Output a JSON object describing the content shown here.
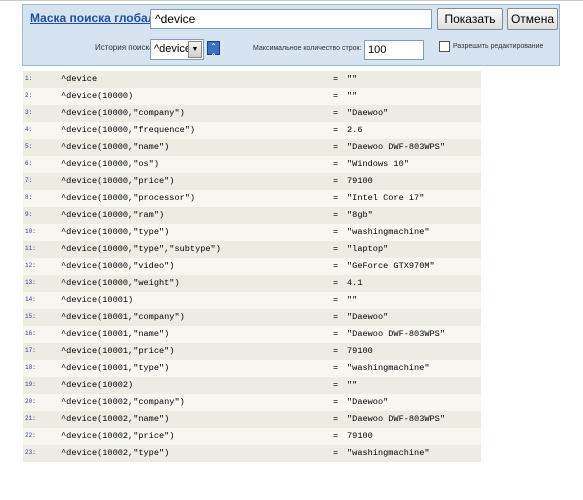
{
  "search": {
    "mask_label": "Маска поиска глобалов:",
    "mask_value": "^device",
    "show_button": "Показать",
    "cancel_button": "Отмена",
    "history_label": "История поиска:",
    "history_selected": "^device",
    "max_rows_label": "Максимальное количество строк:",
    "max_rows_value": "100",
    "allow_edit_label": "Разрешить редактирование",
    "allow_edit_checked": false
  },
  "rows": [
    {
      "num": "1:",
      "key": "^device",
      "val": "\"\""
    },
    {
      "num": "2:",
      "key": "^device(10000)",
      "val": "\"\""
    },
    {
      "num": "3:",
      "key": "^device(10000,\"company\")",
      "val": "\"Daewoo\""
    },
    {
      "num": "4:",
      "key": "^device(10000,\"frequence\")",
      "val": "2.6"
    },
    {
      "num": "5:",
      "key": "^device(10000,\"name\")",
      "val": "\"Daewoo DWF-803WPS\""
    },
    {
      "num": "6:",
      "key": "^device(10000,\"os\")",
      "val": "\"Windows 10\""
    },
    {
      "num": "7:",
      "key": "^device(10000,\"price\")",
      "val": "79100"
    },
    {
      "num": "8:",
      "key": "^device(10000,\"processor\")",
      "val": "\"Intel Core i7\""
    },
    {
      "num": "9:",
      "key": "^device(10000,\"ram\")",
      "val": "\"8gb\""
    },
    {
      "num": "10:",
      "key": "^device(10000,\"type\")",
      "val": "\"washingmachine\""
    },
    {
      "num": "11:",
      "key": "^device(10000,\"type\",\"subtype\")",
      "val": "\"laptop\""
    },
    {
      "num": "12:",
      "key": "^device(10000,\"video\")",
      "val": "\"GeForce GTX970M\""
    },
    {
      "num": "13:",
      "key": "^device(10000,\"weight\")",
      "val": "4.1"
    },
    {
      "num": "14:",
      "key": "^device(10001)",
      "val": "\"\""
    },
    {
      "num": "15:",
      "key": "^device(10001,\"company\")",
      "val": "\"Daewoo\""
    },
    {
      "num": "16:",
      "key": "^device(10001,\"name\")",
      "val": "\"Daewoo DWF-803WPS\""
    },
    {
      "num": "17:",
      "key": "^device(10001,\"price\")",
      "val": "79100"
    },
    {
      "num": "18:",
      "key": "^device(10001,\"type\")",
      "val": "\"washingmachine\""
    },
    {
      "num": "19:",
      "key": "^device(10002)",
      "val": "\"\""
    },
    {
      "num": "20:",
      "key": "^device(10002,\"company\")",
      "val": "\"Daewoo\""
    },
    {
      "num": "21:",
      "key": "^device(10002,\"name\")",
      "val": "\"Daewoo DWF-803WPS\""
    },
    {
      "num": "22:",
      "key": "^device(10002,\"price\")",
      "val": "79100"
    },
    {
      "num": "23:",
      "key": "^device(10002,\"type\")",
      "val": "\"washingmachine\""
    }
  ],
  "eq_sign": "="
}
